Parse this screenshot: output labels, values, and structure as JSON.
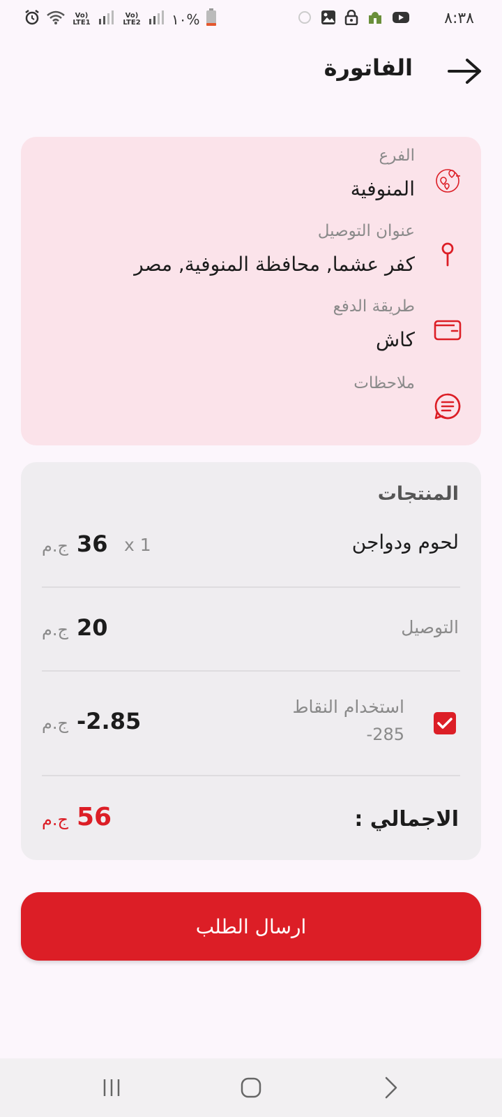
{
  "status_bar": {
    "time": "٨:٣٨",
    "battery": "%١٠",
    "sim1_label": "Vo) LTE2",
    "sim2_label": "Vo) LTE1"
  },
  "header": {
    "title": "الفاتورة"
  },
  "info": {
    "branch_label": "الفرع",
    "branch_value": "المنوفية",
    "address_label": "عنوان التوصيل",
    "address_value": "كفر عشما, محافظة المنوفية, مصر",
    "payment_label": "طريقة الدفع",
    "payment_value": "كاش",
    "notes_label": "ملاحظات"
  },
  "products": {
    "section_title": "المنتجات",
    "items": [
      {
        "name": "لحوم ودواجن",
        "qty": "x 1",
        "amount": "36",
        "currency": "ج.م"
      }
    ],
    "delivery_label": "التوصيل",
    "delivery_amount": "20",
    "delivery_currency": "ج.م",
    "points_label": "استخدام النقاط",
    "points_value": "-285",
    "points_checked": true,
    "points_amount": "-2.85",
    "points_currency": "ج.م",
    "total_label": "الاجمالي :",
    "total_amount": "56",
    "total_currency": "ج.م"
  },
  "submit": {
    "label": "ارسال الطلب"
  },
  "colors": {
    "accent": "#dc1e26",
    "info_card_bg": "#fbe3ea",
    "products_card_bg": "#efedf0"
  }
}
